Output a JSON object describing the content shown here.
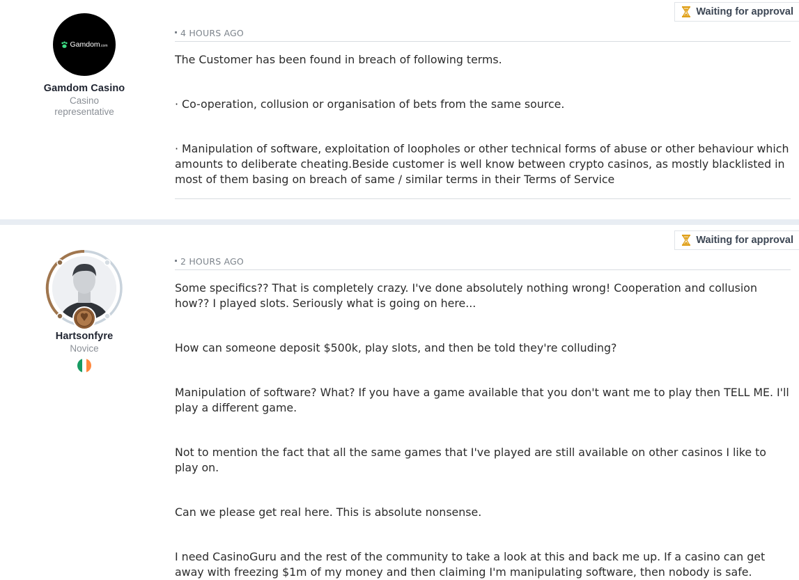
{
  "posts": [
    {
      "author_name": "Gamdom Casino",
      "author_role": "Casino representative",
      "avatar_logo_text": "Gamdom",
      "avatar_logo_suffix": ".com",
      "time": "4 HOURS AGO",
      "status": "Waiting for approval",
      "paragraphs": [
        "The Customer has been found in breach of following terms.",
        "·      Co-operation, collusion or organisation of bets from the same source.",
        "·      Manipulation of software, exploitation of loopholes or other technical forms of abuse or other behaviour which amounts to deliberate cheating.Beside customer is well know between crypto casinos, as mostly blacklisted in most of them basing on breach of same / similar terms in their Terms of Service"
      ]
    },
    {
      "author_name": "Hartsonfyre",
      "author_role": "Novice",
      "country_flag": "Ireland",
      "time": "2 HOURS AGO",
      "status": "Waiting for approval",
      "paragraphs": [
        "Some specifics?? That is completely crazy. I've done absolutely nothing wrong! Cooperation and collusion how?? I played slots. Seriously what is going on here...",
        "How can someone deposit $500k, play slots, and then be told they're colluding?",
        "Manipulation of software? What? If you have a game available that you don't want me to play then TELL ME. I'll play a different game.",
        "Not to mention the fact that all the same games that I've played are still available on other casinos I like to play on.",
        "Can we please get real here. This is absolute nonsense.",
        "I need CasinoGuru and the rest of the community to take a look at this and back me up. If a casino can get away with freezing $1m of my money and then claiming I'm manipulating software, then nobody is safe."
      ]
    }
  ],
  "colors": {
    "separator": "#e8edf3",
    "hourglass": "#e0a11b",
    "muted_text": "#7d848c",
    "rank_ring_bronze": "#a0764e",
    "rank_ring_empty": "#c9d3dc"
  }
}
